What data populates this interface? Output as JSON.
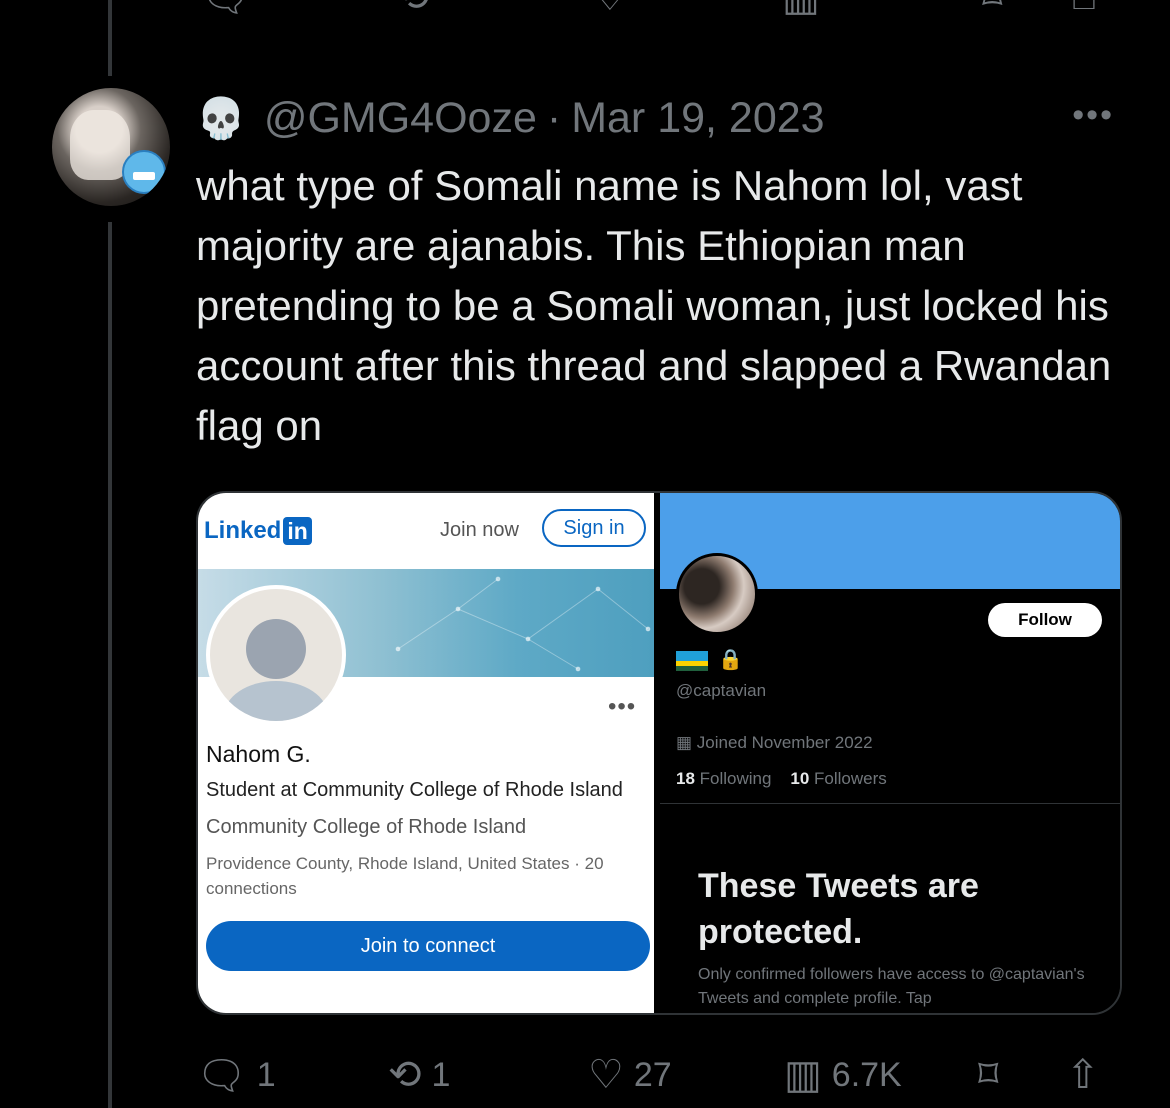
{
  "tweet": {
    "handle": "@GMG4Ooze",
    "separator": "·",
    "date": "Mar 19, 2023",
    "more": "•••",
    "text": "what type of Somali name is Nahom lol, vast majority are ajanabis. This Ethiopian man pretending to be a Somali woman, just locked his account after this thread and slapped a Rwandan flag on",
    "display_name_emoji": "💀"
  },
  "linkedin": {
    "logo_text": "Linked",
    "logo_in": "in",
    "join_now": "Join now",
    "sign_in": "Sign in",
    "more": "•••",
    "name": "Nahom G.",
    "headline": "Student at Community College of Rhode Island",
    "school": "Community College of Rhode Island",
    "location": "Providence County, Rhode Island, United States · 20 connections",
    "connect_button": "Join to connect"
  },
  "twitter_profile": {
    "follow_button": "Follow",
    "lock_icon": "🔒",
    "handle": "@captavian",
    "joined": "Joined November 2022",
    "following_count": "18",
    "following_label": "Following",
    "followers_count": "10",
    "followers_label": "Followers",
    "protected_title": "These Tweets are protected.",
    "protected_body": "Only confirmed followers have access to @captavian's Tweets and complete profile. Tap"
  },
  "actions": {
    "replies": "1",
    "retweets": "1",
    "likes": "27",
    "views": "6.7K"
  },
  "icons": {
    "reply": "reply-icon",
    "retweet": "retweet-icon",
    "like": "heart-icon",
    "views": "views-icon",
    "bookmark": "bookmark-icon",
    "share": "share-icon"
  },
  "colors": {
    "background": "#000000",
    "text": "#e7e9ea",
    "muted": "#71767b",
    "linkedin_blue": "#0a66c2",
    "twitter_banner": "#4c9fea"
  }
}
